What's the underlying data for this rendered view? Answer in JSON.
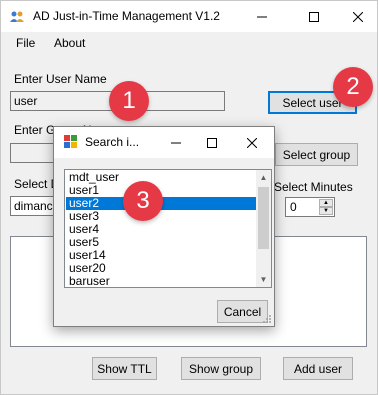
{
  "window": {
    "title": "AD Just-in-Time Management V1.2"
  },
  "menu": {
    "file": "File",
    "about": "About"
  },
  "form": {
    "user_label": "Enter User Name",
    "user_value": "user",
    "select_user_button": "Select user",
    "group_label": "Enter Group Name",
    "group_value": "",
    "select_group_button": "Select group",
    "day_label": "Select Day",
    "day_value": "dimanche",
    "minutes_label": "Select Minutes",
    "minutes_value": "0"
  },
  "bottom_buttons": {
    "show_ttl": "Show TTL",
    "show_group": "Show group",
    "add_user": "Add user"
  },
  "dialog": {
    "title": "Search i...",
    "items": [
      "mdt_user",
      "user1",
      "user2",
      "user3",
      "user4",
      "user5",
      "user14",
      "user20",
      "baruser"
    ],
    "selected_index": 2,
    "cancel_button": "Cancel"
  },
  "annotations": {
    "badge_1": "1",
    "badge_2": "2",
    "badge_3": "3"
  },
  "colors": {
    "accent": "#0078d7",
    "badge": "#e63946"
  }
}
